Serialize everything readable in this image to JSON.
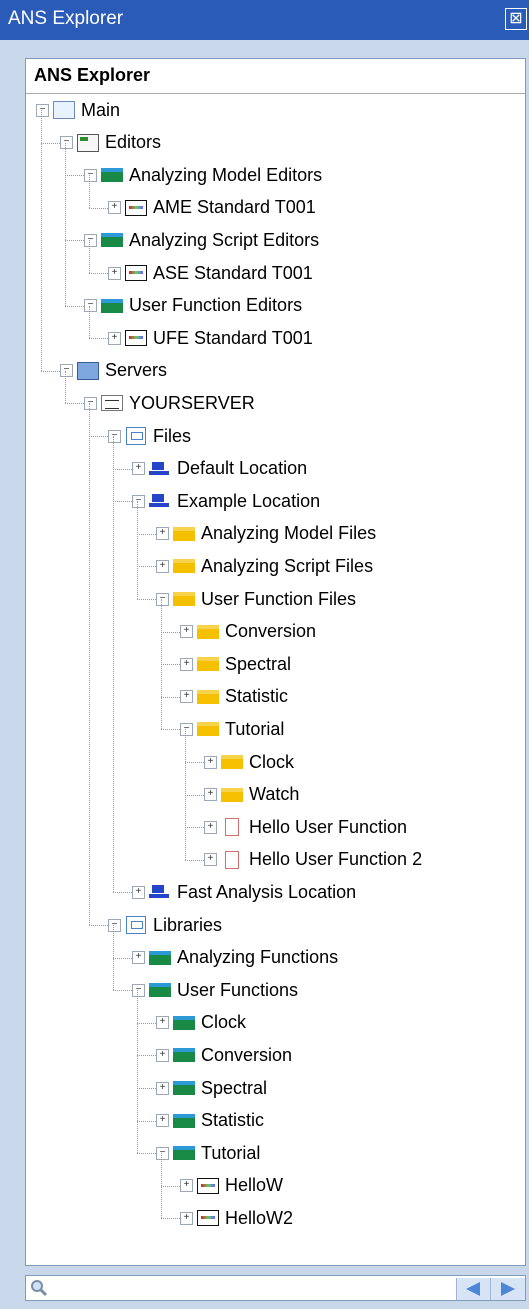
{
  "window": {
    "title": "ANS Explorer",
    "close_glyph": "⊠"
  },
  "panel": {
    "title": "ANS Explorer"
  },
  "tree": [
    {
      "label": "Main",
      "level": 0,
      "icon": "main-icon",
      "expanded": true
    },
    {
      "label": "Editors",
      "level": 1,
      "icon": "editors-icon",
      "expanded": true
    },
    {
      "label": "Analyzing Model Editors",
      "level": 2,
      "icon": "folder-green-icon",
      "expanded": true
    },
    {
      "label": "AME Standard T001",
      "level": 3,
      "icon": "editor-file-icon",
      "expanded": false
    },
    {
      "label": "Analyzing Script Editors",
      "level": 2,
      "icon": "folder-green-icon",
      "expanded": true
    },
    {
      "label": "ASE Standard T001",
      "level": 3,
      "icon": "editor-file-icon",
      "expanded": false
    },
    {
      "label": "User Function Editors",
      "level": 2,
      "icon": "folder-green-icon",
      "expanded": true
    },
    {
      "label": "UFE Standard T001",
      "level": 3,
      "icon": "editor-file-icon",
      "expanded": false
    },
    {
      "label": "Servers",
      "level": 1,
      "icon": "servers-icon",
      "expanded": true
    },
    {
      "label": "YOURSERVER",
      "level": 2,
      "icon": "server-icon",
      "expanded": true
    },
    {
      "label": "Files",
      "level": 3,
      "icon": "library-icon",
      "expanded": true
    },
    {
      "label": "Default Location",
      "level": 4,
      "icon": "location-icon",
      "expanded": false
    },
    {
      "label": "Example Location",
      "level": 4,
      "icon": "location-icon",
      "expanded": true
    },
    {
      "label": "Analyzing Model Files",
      "level": 5,
      "icon": "folder-yellow-icon",
      "expanded": false
    },
    {
      "label": "Analyzing Script Files",
      "level": 5,
      "icon": "folder-yellow-icon",
      "expanded": false
    },
    {
      "label": "User Function Files",
      "level": 5,
      "icon": "folder-yellow-icon",
      "expanded": true
    },
    {
      "label": "Conversion",
      "level": 6,
      "icon": "folder-yellow-icon",
      "expanded": false
    },
    {
      "label": "Spectral",
      "level": 6,
      "icon": "folder-yellow-icon",
      "expanded": false
    },
    {
      "label": "Statistic",
      "level": 6,
      "icon": "folder-yellow-icon",
      "expanded": false
    },
    {
      "label": "Tutorial",
      "level": 6,
      "icon": "folder-yellow-icon",
      "expanded": true
    },
    {
      "label": "Clock",
      "level": 7,
      "icon": "folder-yellow-icon",
      "expanded": false
    },
    {
      "label": "Watch",
      "level": 7,
      "icon": "folder-yellow-icon",
      "expanded": false
    },
    {
      "label": "Hello User Function",
      "level": 7,
      "icon": "document-icon",
      "expanded": false
    },
    {
      "label": "Hello User Function 2",
      "level": 7,
      "icon": "document-icon",
      "expanded": false
    },
    {
      "label": "Fast Analysis Location",
      "level": 4,
      "icon": "location-icon",
      "expanded": false
    },
    {
      "label": "Libraries",
      "level": 3,
      "icon": "library-icon",
      "expanded": true
    },
    {
      "label": "Analyzing Functions",
      "level": 4,
      "icon": "folder-green-icon",
      "expanded": false
    },
    {
      "label": "User Functions",
      "level": 4,
      "icon": "folder-green-icon",
      "expanded": true
    },
    {
      "label": "Clock",
      "level": 5,
      "icon": "folder-green-icon",
      "expanded": false
    },
    {
      "label": "Conversion",
      "level": 5,
      "icon": "folder-green-icon",
      "expanded": false
    },
    {
      "label": "Spectral",
      "level": 5,
      "icon": "folder-green-icon",
      "expanded": false
    },
    {
      "label": "Statistic",
      "level": 5,
      "icon": "folder-green-icon",
      "expanded": false
    },
    {
      "label": "Tutorial",
      "level": 5,
      "icon": "folder-green-icon",
      "expanded": true
    },
    {
      "label": "HelloW",
      "level": 6,
      "icon": "editor-file-icon",
      "expanded": false
    },
    {
      "label": "HelloW2",
      "level": 6,
      "icon": "editor-file-icon",
      "expanded": false
    }
  ],
  "search": {
    "placeholder": ""
  },
  "colors": {
    "titlebar": "#2a5bb8",
    "panel_border": "#7f9db9",
    "green_folder": "#188a45",
    "yellow_folder": "#f4c000",
    "nav_arrow": "#4b86d7"
  }
}
